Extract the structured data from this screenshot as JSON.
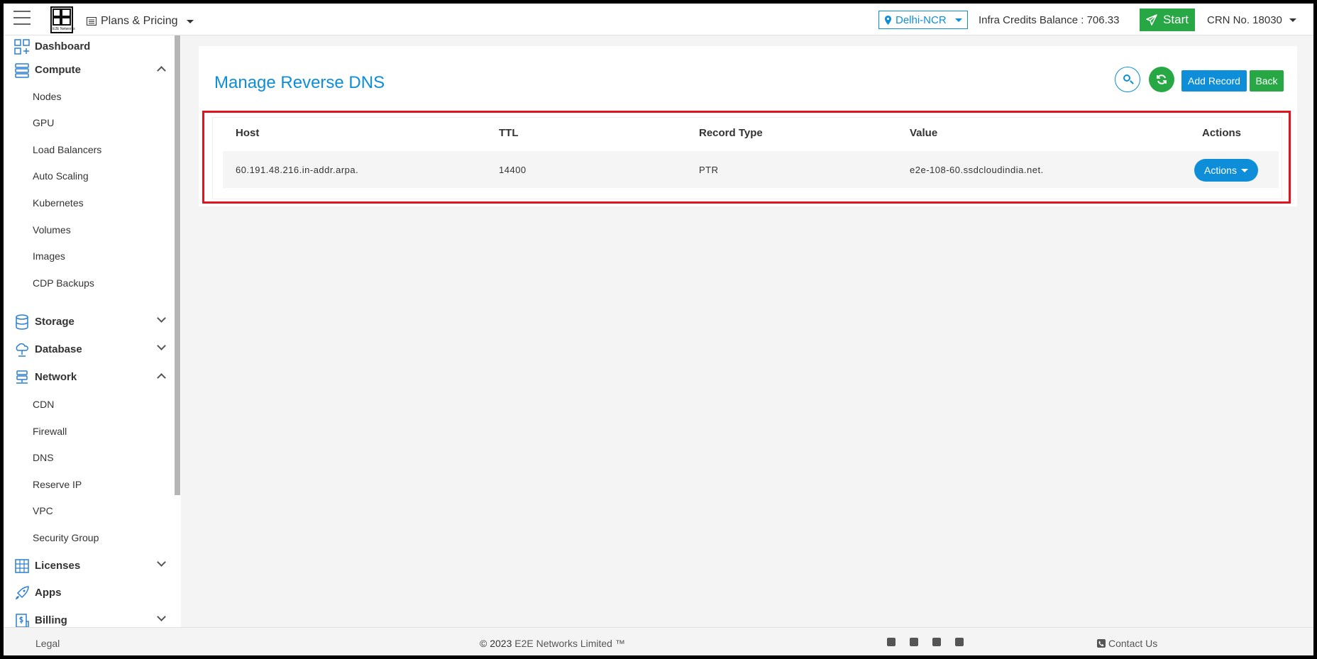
{
  "header": {
    "logo_text": "E2E Networks",
    "plans_label": "Plans & Pricing",
    "region": "Delhi-NCR",
    "credits": "Infra Credits Balance : 706.33",
    "start_label": "Start",
    "crn": "CRN No. 18030"
  },
  "sidebar": {
    "dashboard": "Dashboard",
    "compute": "Compute",
    "compute_items": [
      "Nodes",
      "GPU",
      "Load Balancers",
      "Auto Scaling",
      "Kubernetes",
      "Volumes",
      "Images",
      "CDP Backups"
    ],
    "storage": "Storage",
    "database": "Database",
    "network": "Network",
    "network_items": [
      "CDN",
      "Firewall",
      "DNS",
      "Reserve IP",
      "VPC",
      "Security Group"
    ],
    "licenses": "Licenses",
    "apps": "Apps",
    "billing": "Billing"
  },
  "main": {
    "title": "Manage Reverse DNS",
    "add_record": "Add Record",
    "back": "Back",
    "columns": [
      "Host",
      "TTL",
      "Record Type",
      "Value",
      "Actions"
    ],
    "rows": [
      {
        "host": "60.191.48.216.in-addr.arpa.",
        "ttl": "14400",
        "type": "PTR",
        "value": "e2e-108-60.ssdcloudindia.net.",
        "action": "Actions"
      }
    ]
  },
  "footer": {
    "legal": "Legal",
    "copyright_prefix": "© 2023",
    "company": "E2E Networks Limited ™",
    "contact": "Contact Us"
  },
  "colors": {
    "primary": "#0e8ed8",
    "success": "#28a745",
    "highlight": "#e0141e"
  }
}
